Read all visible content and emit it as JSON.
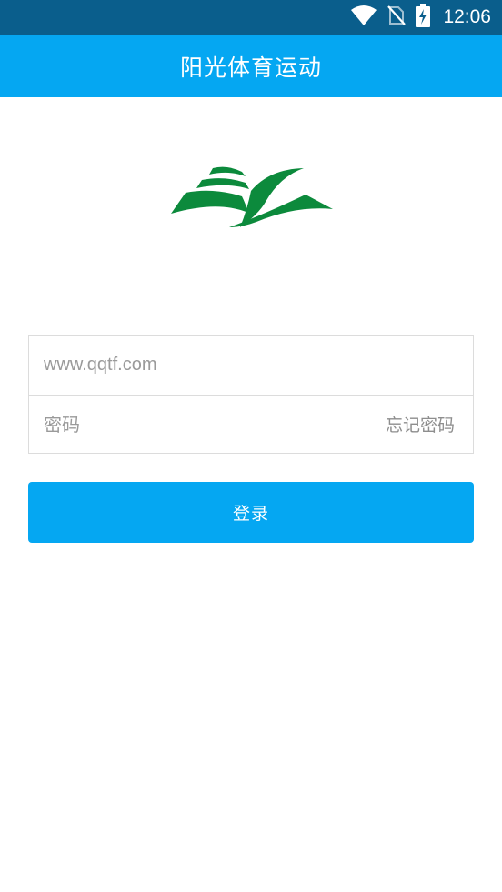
{
  "status_bar": {
    "time": "12:06",
    "icons": [
      "wifi-icon",
      "no-sim-icon",
      "battery-charging-icon"
    ]
  },
  "app_bar": {
    "title": "阳光体育运动"
  },
  "logo": {
    "icon": "book-leaf-logo",
    "colors": {
      "green": "#0c8a3c"
    }
  },
  "login_form": {
    "username_placeholder": "www.qqtf.com",
    "password_placeholder": "密码",
    "forgot_password_label": "忘记密码",
    "login_button_label": "登录"
  },
  "colors": {
    "status_bar": "#0a5e8c",
    "accent": "#05a7f2"
  }
}
